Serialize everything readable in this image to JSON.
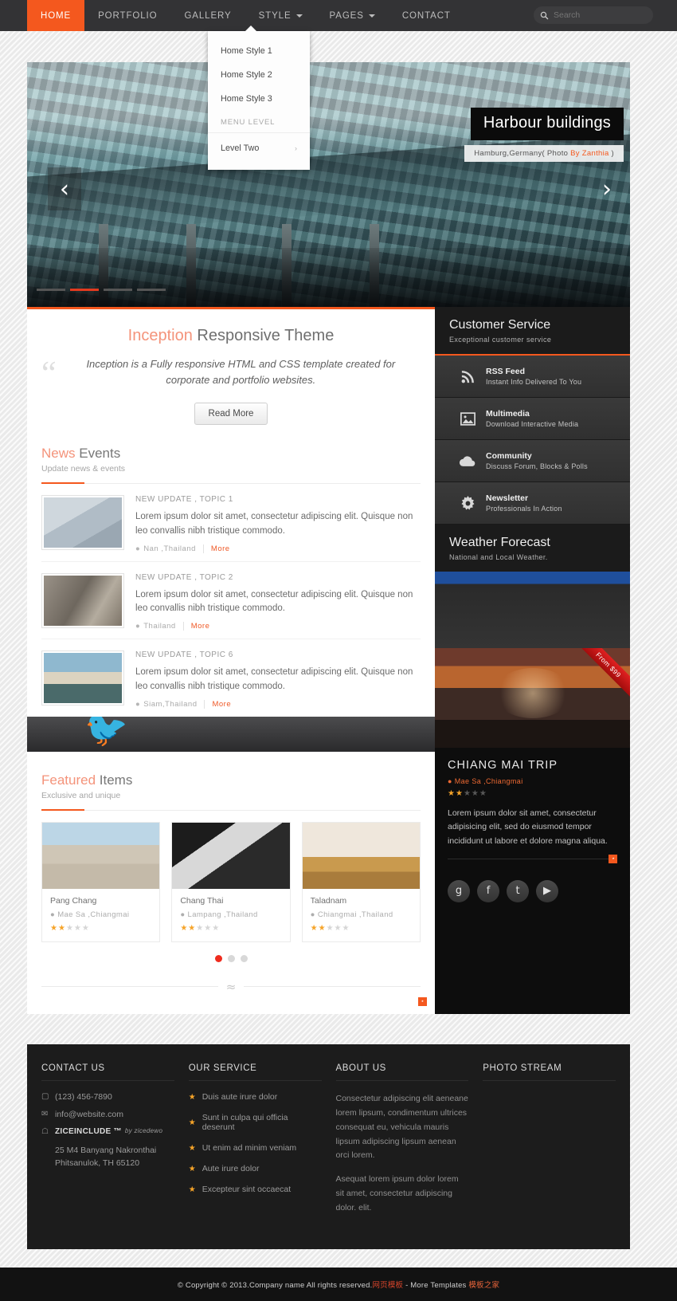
{
  "nav": {
    "items": [
      {
        "label": "HOME",
        "active": true,
        "caret": false
      },
      {
        "label": "PORTFOLIO",
        "active": false,
        "caret": false
      },
      {
        "label": "GALLERY",
        "active": false,
        "caret": false
      },
      {
        "label": "STYLE",
        "active": false,
        "caret": true
      },
      {
        "label": "PAGES",
        "active": false,
        "caret": true
      },
      {
        "label": "CONTACT",
        "active": false,
        "caret": false
      }
    ],
    "search_placeholder": "Search",
    "search_value": ""
  },
  "dropdown": {
    "items": [
      "Home Style 1",
      "Home Style 2",
      "Home Style 3"
    ],
    "group_label": "MENU LEVEL",
    "submenu": "Level Two",
    "submenu_arrow": "›"
  },
  "slider": {
    "caption_title": "Harbour buildings",
    "caption_pre": "Hamburg,Germany( Photo ",
    "caption_link": "By Zanthia",
    "caption_post": " )",
    "prev": "‹",
    "next": "›"
  },
  "intro": {
    "title_accent": "Inception",
    "title_rest": " Responsive Theme",
    "quote": "Inception is a Fully responsive HTML and CSS template created for corporate and portfolio websites.",
    "button": "Read More"
  },
  "news": {
    "heading_accent": "News",
    "heading_rest": " Events",
    "subheading": "Update news & events",
    "items": [
      {
        "kicker": "NEW UPDATE , TOPIC 1",
        "text": "Lorem ipsum dolor sit amet, consectetur adipiscing elit. Quisque non leo convallis nibh tristique commodo.",
        "location": "Nan ,Thailand",
        "more": "More"
      },
      {
        "kicker": "NEW UPDATE , TOPIC 2",
        "text": "Lorem ipsum dolor sit amet, consectetur adipiscing elit. Quisque non leo convallis nibh tristique commodo.",
        "location": "Thailand",
        "more": "More"
      },
      {
        "kicker": "NEW UPDATE , TOPIC 6",
        "text": "Lorem ipsum dolor sit amet, consectetur adipiscing elit. Quisque non leo convallis nibh tristique commodo.",
        "location": "Siam,Thailand",
        "more": "More"
      }
    ]
  },
  "featured": {
    "heading_accent": "Featured",
    "heading_rest": " Items",
    "subheading": "Exclusive and unique",
    "cards": [
      {
        "title": "Pang Chang",
        "location": "Mae Sa ,Chiangmai",
        "rating": 2,
        "max": 5
      },
      {
        "title": "Chang Thai",
        "location": "Lampang ,Thailand",
        "rating": 2,
        "max": 5
      },
      {
        "title": "Taladnam",
        "location": "Chiangmai ,Thailand",
        "rating": 2,
        "max": 5
      }
    ],
    "pager": {
      "count": 3,
      "active": 0
    }
  },
  "customer_service": {
    "title": "Customer Service",
    "subtitle": "Exceptional customer service",
    "items": [
      {
        "icon": "rss-icon",
        "title": "RSS Feed",
        "subtitle": "Instant Info Delivered To You"
      },
      {
        "icon": "image-icon",
        "title": "Multimedia",
        "subtitle": "Download Interactive Media"
      },
      {
        "icon": "cloud-icon",
        "title": "Community",
        "subtitle": "Discuss Forum, Blocks & Polls"
      },
      {
        "icon": "gear-icon",
        "title": "Newsletter",
        "subtitle": "Professionals In Action"
      }
    ]
  },
  "weather": {
    "title": "Weather Forecast",
    "subtitle": "National and Local Weather."
  },
  "trip": {
    "ribbon": "From $99",
    "title": "CHIANG MAI TRIP",
    "location": "Mae Sa ,Chiangmai",
    "rating": 2,
    "max": 5,
    "text": "Lorem ipsum dolor sit amet, consectetur adipisicing elit, sed do eiusmod tempor incididunt ut labore et dolore magna aliqua.",
    "socials": [
      {
        "name": "google-plus-icon",
        "glyph": "g"
      },
      {
        "name": "facebook-icon",
        "glyph": "f"
      },
      {
        "name": "twitter-icon",
        "glyph": "t"
      },
      {
        "name": "youtube-icon",
        "glyph": "▶"
      }
    ]
  },
  "footer": {
    "contact": {
      "heading": "CONTACT US",
      "phone": "(123) 456-7890",
      "email": "info@website.com",
      "brand": "ZICEINCLUDE ™",
      "brand_by": "by zicedewo",
      "address_line1": "25 M4 Banyang Nakronthai",
      "address_line2": "Phitsanulok, TH 65120"
    },
    "service": {
      "heading": "OUR SERVICE",
      "items": [
        "Duis aute irure dolor",
        "Sunt in culpa qui officia deserunt",
        "Ut enim ad minim veniam",
        "Aute irure dolor",
        "Excepteur sint occaecat"
      ]
    },
    "about": {
      "heading": "ABOUT US",
      "p1": "Consectetur adipiscing elit aeneane lorem lipsum, condimentum ultrices consequat eu, vehicula mauris lipsum adipiscing lipsum aenean orci lorem.",
      "p2": "Asequat lorem ipsum dolor lorem sit amet, consectetur adipiscing dolor. elit."
    },
    "photo": {
      "heading": "PHOTO STREAM"
    }
  },
  "copyright": {
    "pre": "© Copyright © 2013.Company name All rights reserved.",
    "red1": "网页模板",
    "mid": " - More Templates ",
    "red2": "模板之家"
  },
  "colors": {
    "accent": "#f4581e",
    "dark": "#1c1c1c",
    "star": "#f6a429"
  }
}
